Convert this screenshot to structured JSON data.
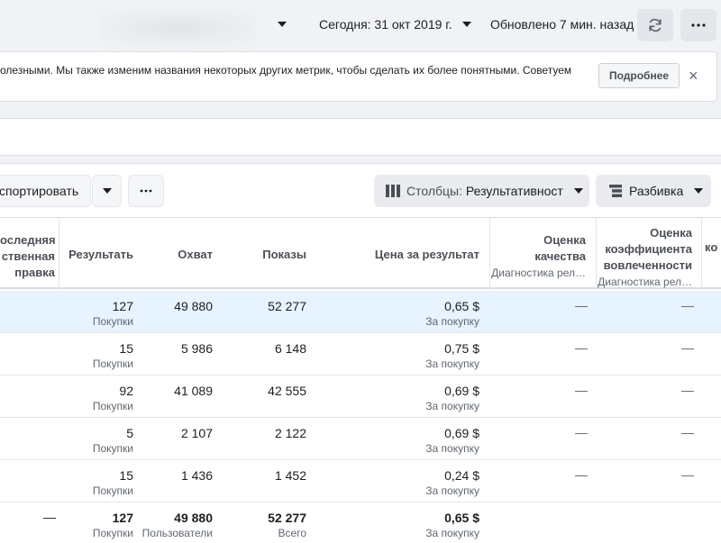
{
  "topbar": {
    "date_label": "Сегодня: 31 окт 2019 г.",
    "updated_label": "Обновлено 7 мин. назад"
  },
  "notice": {
    "text": "олезными. Мы также изменим названия некоторых других метрик, чтобы сделать их более понятными. Советуем",
    "details_label": "Подробнее",
    "close_symbol": "×"
  },
  "toolbar": {
    "export_label": "спортировать",
    "columns_prefix": "Столбцы: ",
    "columns_value": "Результативност",
    "breakdown_label": "Разбивка",
    "more_symbol": "···"
  },
  "headers": {
    "last_edit": [
      "оследняя",
      "ственная",
      "правка"
    ],
    "results": "Результать",
    "reach": "Охват",
    "impressions": "Показы",
    "cost_per_result": "Цена за результат",
    "quality": [
      "Оценка",
      "качества"
    ],
    "quality_sub": "Диагностика рел…",
    "engagement": [
      "Оценка",
      "коэффициента",
      "вовлеченности"
    ],
    "engagement_sub": "Диагностика рел…",
    "next_partial": "ко"
  },
  "rows": [
    {
      "result": "127",
      "result_type": "Покупки",
      "reach": "49 880",
      "impressions": "52 277",
      "cost": "0,65 $",
      "cost_type": "За покупку",
      "quality": "—",
      "engagement": "—",
      "selected": true
    },
    {
      "result": "15",
      "result_type": "Покупки",
      "reach": "5 986",
      "impressions": "6 148",
      "cost": "0,75 $",
      "cost_type": "За покупку",
      "quality": "—",
      "engagement": "—",
      "selected": false
    },
    {
      "result": "92",
      "result_type": "Покупки",
      "reach": "41 089",
      "impressions": "42 555",
      "cost": "0,69 $",
      "cost_type": "За покупку",
      "quality": "—",
      "engagement": "—",
      "selected": false
    },
    {
      "result": "5",
      "result_type": "Покупки",
      "reach": "2 107",
      "impressions": "2 122",
      "cost": "0,69 $",
      "cost_type": "За покупку",
      "quality": "—",
      "engagement": "—",
      "selected": false
    },
    {
      "result": "15",
      "result_type": "Покупки",
      "reach": "1 436",
      "impressions": "1 452",
      "cost": "0,24 $",
      "cost_type": "За покупку",
      "quality": "—",
      "engagement": "—",
      "selected": false
    }
  ],
  "total": {
    "last_edit": "—",
    "result": "127",
    "result_type": "Покупки",
    "reach": "49 880",
    "reach_type": "Пользователи",
    "impressions": "52 277",
    "impressions_type": "Всего",
    "cost": "0,65 $",
    "cost_type": "За покупку"
  },
  "colors": {
    "selected_row": "#e7f3ff",
    "button_bg": "#e4e6eb",
    "page_bg": "#f0f2f5"
  }
}
